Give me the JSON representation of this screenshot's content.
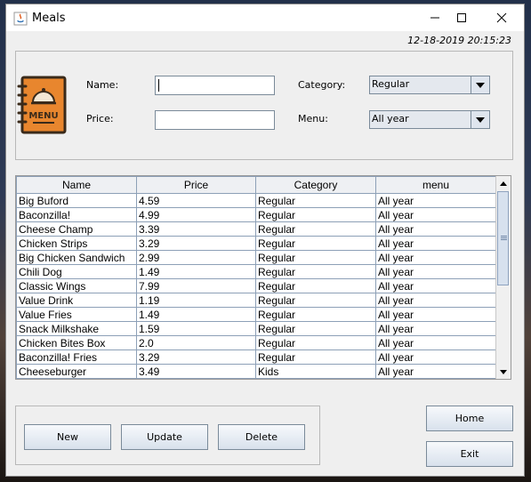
{
  "window": {
    "title": "Meals"
  },
  "timestamp": "12-18-2019 20:15:23",
  "form": {
    "name_label": "Name:",
    "name_value": "",
    "price_label": "Price:",
    "price_value": "",
    "category_label": "Category:",
    "category_value": "Regular",
    "menu_label": "Menu:",
    "menu_value": "All year",
    "menu_icon_text": "MENU"
  },
  "table": {
    "columns": [
      "Name",
      "Price",
      "Category",
      "menu"
    ],
    "rows": [
      [
        "Big Buford",
        "4.59",
        "Regular",
        "All year"
      ],
      [
        "Baconzilla!",
        "4.99",
        "Regular",
        "All year"
      ],
      [
        "Cheese Champ",
        "3.39",
        "Regular",
        "All year"
      ],
      [
        "Chicken Strips",
        "3.29",
        "Regular",
        "All year"
      ],
      [
        "Big Chicken Sandwich",
        "2.99",
        "Regular",
        "All year"
      ],
      [
        "Chili Dog",
        "1.49",
        "Regular",
        "All year"
      ],
      [
        "Classic Wings",
        "7.99",
        "Regular",
        "All year"
      ],
      [
        "Value Drink",
        "1.19",
        "Regular",
        "All year"
      ],
      [
        "Value Fries",
        "1.49",
        "Regular",
        "All year"
      ],
      [
        "Snack Milkshake",
        "1.59",
        "Regular",
        "All year"
      ],
      [
        "Chicken Bites Box",
        "2.0",
        "Regular",
        "All year"
      ],
      [
        "Baconzilla! Fries",
        "3.29",
        "Regular",
        "All year"
      ],
      [
        "Cheeseburger",
        "3.49",
        "Kids",
        "All year"
      ]
    ]
  },
  "buttons": {
    "new": "New",
    "update": "Update",
    "delete": "Delete",
    "home": "Home",
    "exit": "Exit"
  },
  "icons": {
    "app": "java-icon",
    "menu": "menu-book-icon",
    "minimize": "minimize-icon",
    "maximize": "maximize-icon",
    "close": "close-icon"
  },
  "colors": {
    "menu_icon_orange": "#e8862e",
    "table_grid": "#8da0b7",
    "scroll_thumb": "#d7e1ee"
  }
}
